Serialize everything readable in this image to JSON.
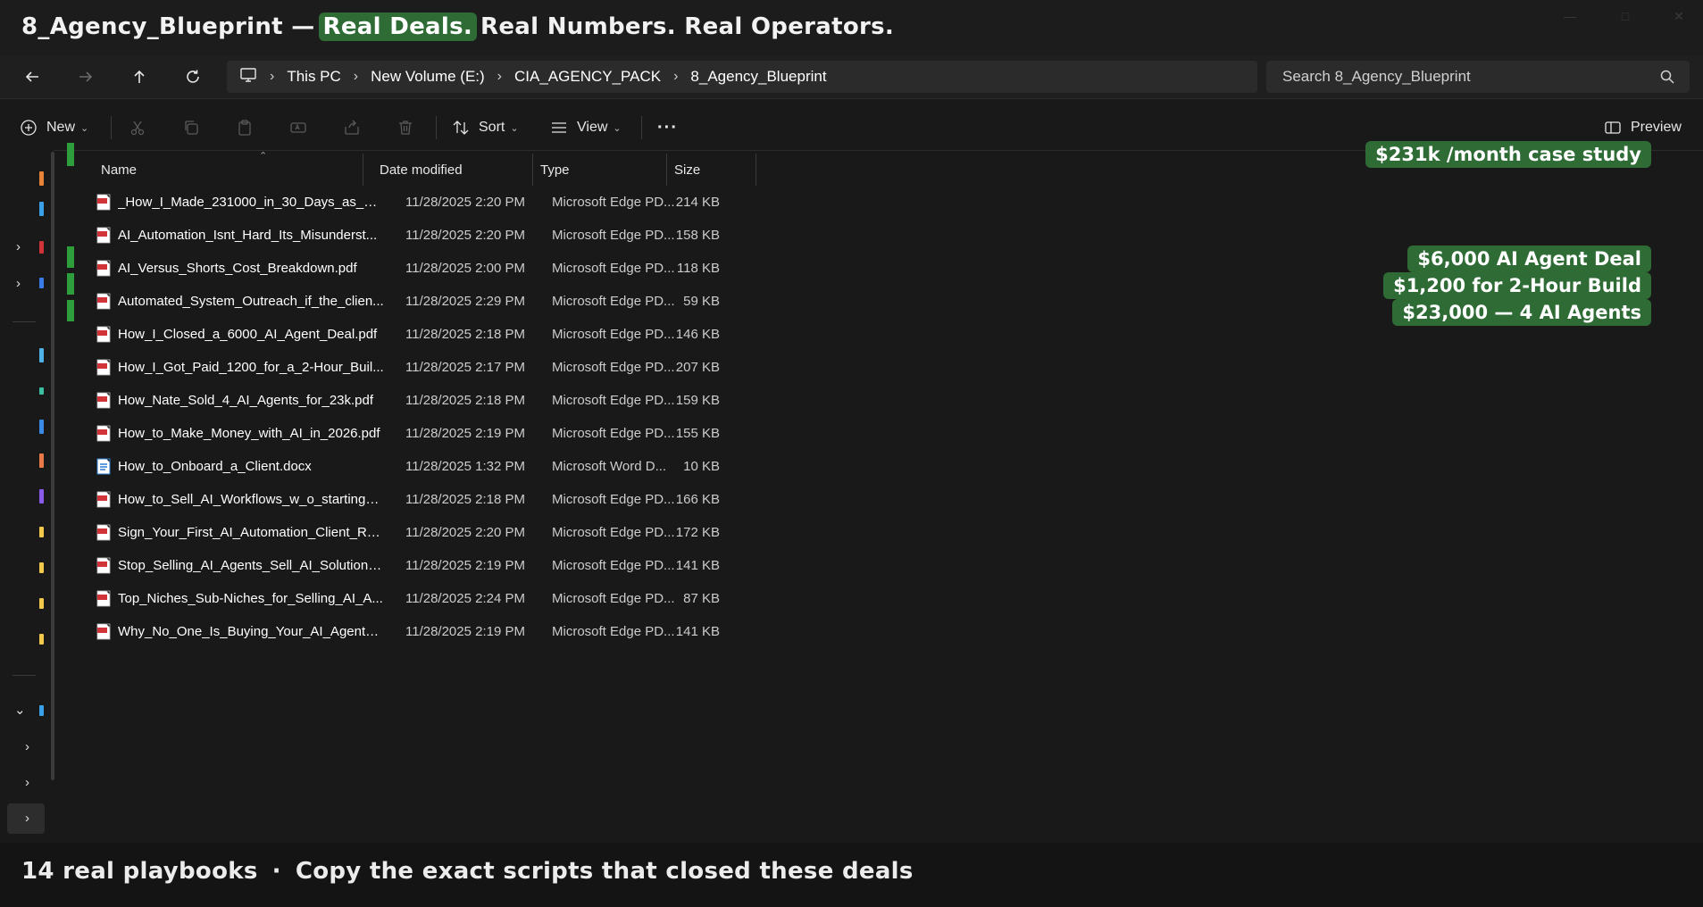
{
  "headline": {
    "prefix": "8_Agency_Blueprint —",
    "highlight": "Real Deals.",
    "suffix": "Real Numbers. Real Operators."
  },
  "breadcrumb": [
    "This PC",
    "New Volume (E:)",
    "CIA_AGENCY_PACK",
    "8_Agency_Blueprint"
  ],
  "search": {
    "placeholder": "Search 8_Agency_Blueprint"
  },
  "toolbar": {
    "new_label": "New",
    "sort_label": "Sort",
    "view_label": "View",
    "more_label": "···",
    "preview_label": "Preview"
  },
  "columns": {
    "name": "Name",
    "date": "Date modified",
    "type": "Type",
    "size": "Size"
  },
  "files": [
    {
      "name": "_How_I_Made_231000_in_30_Days_as_an_...",
      "date": "11/28/2025 2:20 PM",
      "type": "Microsoft Edge PD...",
      "size": "214 KB",
      "icon": "pdf-file-icon"
    },
    {
      "name": "AI_Automation_Isnt_Hard_Its_Misunderst...",
      "date": "11/28/2025 2:20 PM",
      "type": "Microsoft Edge PD...",
      "size": "158 KB",
      "icon": "pdf-file-icon"
    },
    {
      "name": "AI_Versus_Shorts_Cost_Breakdown.pdf",
      "date": "11/28/2025 2:00 PM",
      "type": "Microsoft Edge PD...",
      "size": "118 KB",
      "icon": "pdf-file-icon"
    },
    {
      "name": "Automated_System_Outreach_if_the_clien...",
      "date": "11/28/2025 2:29 PM",
      "type": "Microsoft Edge PD...",
      "size": "59 KB",
      "icon": "pdf-file-icon"
    },
    {
      "name": "How_I_Closed_a_6000_AI_Agent_Deal.pdf",
      "date": "11/28/2025 2:18 PM",
      "type": "Microsoft Edge PD...",
      "size": "146 KB",
      "icon": "pdf-file-icon"
    },
    {
      "name": "How_I_Got_Paid_1200_for_a_2-Hour_Buil...",
      "date": "11/28/2025 2:17 PM",
      "type": "Microsoft Edge PD...",
      "size": "207 KB",
      "icon": "pdf-file-icon"
    },
    {
      "name": "How_Nate_Sold_4_AI_Agents_for_23k.pdf",
      "date": "11/28/2025 2:18 PM",
      "type": "Microsoft Edge PD...",
      "size": "159 KB",
      "icon": "pdf-file-icon"
    },
    {
      "name": "How_to_Make_Money_with_AI_in_2026.pdf",
      "date": "11/28/2025 2:19 PM",
      "type": "Microsoft Edge PD...",
      "size": "155 KB",
      "icon": "pdf-file-icon"
    },
    {
      "name": "How_to_Onboard_a_Client.docx",
      "date": "11/28/2025 1:32 PM",
      "type": "Microsoft Word D...",
      "size": "10 KB",
      "icon": "word-file-icon"
    },
    {
      "name": "How_to_Sell_AI_Workflows_w_o_starting_...",
      "date": "11/28/2025 2:18 PM",
      "type": "Microsoft Edge PD...",
      "size": "166 KB",
      "icon": "pdf-file-icon"
    },
    {
      "name": "Sign_Your_First_AI_Automation_Client_Re...",
      "date": "11/28/2025 2:20 PM",
      "type": "Microsoft Edge PD...",
      "size": "172 KB",
      "icon": "pdf-file-icon"
    },
    {
      "name": "Stop_Selling_AI_Agents_Sell_AI_Solutions...",
      "date": "11/28/2025 2:19 PM",
      "type": "Microsoft Edge PD...",
      "size": "141 KB",
      "icon": "pdf-file-icon"
    },
    {
      "name": "Top_Niches_Sub-Niches_for_Selling_AI_A...",
      "date": "11/28/2025 2:24 PM",
      "type": "Microsoft Edge PD...",
      "size": "87 KB",
      "icon": "pdf-file-icon"
    },
    {
      "name": "Why_No_One_Is_Buying_Your_AI_Agents_...",
      "date": "11/28/2025 2:19 PM",
      "type": "Microsoft Edge PD...",
      "size": "141 KB",
      "icon": "pdf-file-icon"
    }
  ],
  "badges": [
    "$231k /month case study",
    "$6,000 AI Agent Deal",
    "$1,200 for 2-Hour Build",
    "$23,000 — 4 AI Agents"
  ],
  "tagline": {
    "left": "14 real playbooks",
    "separator": "·",
    "right": "Copy the exact scripts that closed these deals"
  },
  "colors": {
    "background": "#191919",
    "accent_green": "#2e6b35",
    "pdf_red": "#d13438",
    "word_blue": "#2b7cd3"
  }
}
